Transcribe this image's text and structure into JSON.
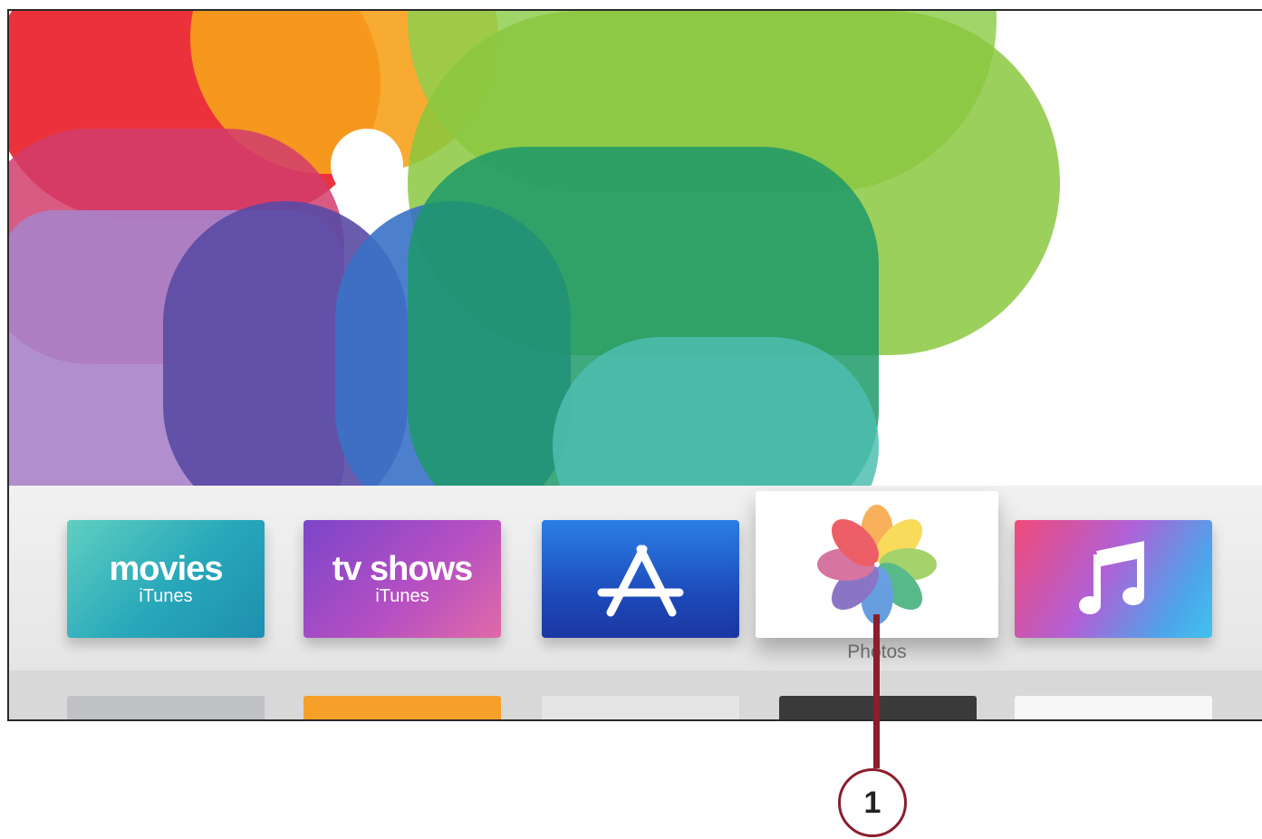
{
  "home_screen": {
    "dock": {
      "apps": [
        {
          "name": "movies",
          "subtitle": "iTunes",
          "icon": "movies-tile"
        },
        {
          "name": "tv shows",
          "subtitle": "iTunes",
          "icon": "tv-shows-tile"
        },
        {
          "name": "App Store",
          "icon": "app-store-icon"
        },
        {
          "name": "Photos",
          "icon": "photos-icon",
          "focused": true
        },
        {
          "name": "Music",
          "icon": "music-note-icon"
        }
      ],
      "focused_label": "Photos"
    }
  },
  "annotation": {
    "callout_number": "1"
  },
  "colors": {
    "callout": "#8a1e2d",
    "focus_label": "#6a6a6a"
  }
}
